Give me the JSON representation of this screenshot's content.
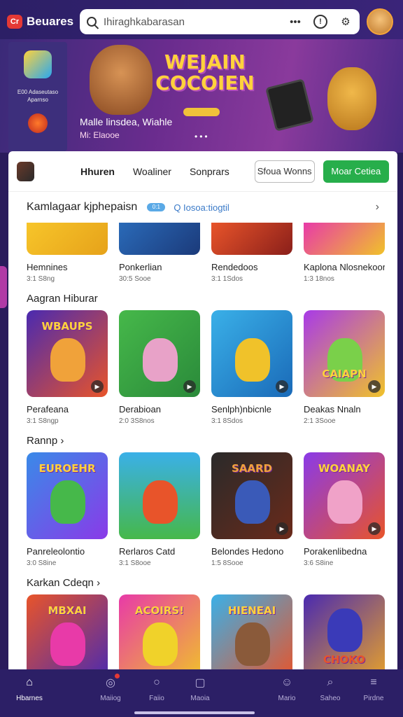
{
  "topbar": {
    "brand_logo": "Cr",
    "brand_name": "Beuares",
    "search_text": "Ihiraghkabarasan",
    "more_icon": "•••",
    "info_icon": "!",
    "gear_icon": "⚙"
  },
  "hero": {
    "title": "WEJAIN COCOIEN",
    "side_text": "E00 Adaseutaso Aparnso",
    "caption": "Malle linsdea, Wiahle",
    "sub": "Mi: Elaooe",
    "dots": "•••"
  },
  "tabs": {
    "items": [
      "Hhuren",
      "Woaliner",
      "Sonprars"
    ],
    "outline_button": "Sfoua Wonns",
    "primary_button": "Moar Cetiea"
  },
  "section1": {
    "title": "Kamlagaar kjphepaisn",
    "badge": "0:1",
    "link": "Q Iosoa:tiogtil",
    "chevron": "›",
    "cards": [
      {
        "title": "Hemnines",
        "meta": "3:1 S8ng",
        "label": "",
        "color1": "#f7c52a",
        "color2": "#e6a21a"
      },
      {
        "title": "Ponkerlian",
        "meta": "30:5 Sooe",
        "label": "",
        "color1": "#2a6ab8",
        "color2": "#1b3a7a"
      },
      {
        "title": "Rendedoos",
        "meta": "3:1 1Sdos",
        "label": "",
        "color1": "#e8542a",
        "color2": "#8a1f1a"
      },
      {
        "title": "Kaplona Nlosnekoor",
        "meta": "1:3 18nos",
        "label": "",
        "color1": "#e83aa8",
        "color2": "#f0c22a"
      }
    ]
  },
  "section2": {
    "title": "Aagran Hiburar",
    "cards": [
      {
        "title": "Perafeana",
        "meta": "3:1 S8ngp",
        "label": "WBAUPS",
        "color1": "#4a2ab0",
        "color2": "#e8542a"
      },
      {
        "title": "Derabioan",
        "meta": "2:0 3S8nos",
        "label": "",
        "color1": "#46b84a",
        "color2": "#2a8a3a"
      },
      {
        "title": "Senlph)nbicnle",
        "meta": "3:1 8Sdos",
        "label": "",
        "color1": "#3ab0e8",
        "color2": "#1a6ab8"
      },
      {
        "title": "Deakas Nnaln",
        "meta": "2:1 3Sooe",
        "label": "CAIAPN",
        "color1": "#a83ae8",
        "color2": "#f0c22a"
      }
    ]
  },
  "section3": {
    "title": "Rannp ›",
    "cards": [
      {
        "title": "Panreleolontio",
        "meta": "3:0 S8ine",
        "label": "EUROEHR",
        "color1": "#3a8ae8",
        "color2": "#8a3ae8"
      },
      {
        "title": "Rerlaros Catd",
        "meta": "3:1 S8ooe",
        "label": "",
        "color1": "#3ab0e8",
        "color2": "#46b84a"
      },
      {
        "title": "Belondes Hedono",
        "meta": "1:5 8Sooe",
        "label": "SAARD",
        "color1": "#2a2a2a",
        "color2": "#6a2a1a"
      },
      {
        "title": "Porakenlibedna",
        "meta": "3:6 S8ine",
        "label": "WOANAY",
        "color1": "#8a3ae8",
        "color2": "#e8542a"
      }
    ]
  },
  "section4": {
    "title": "Karkan Cdeqn ›",
    "cards": [
      {
        "title": "",
        "meta": "",
        "label": "MBXAI",
        "color1": "#e8542a",
        "color2": "#4a2ab0"
      },
      {
        "title": "",
        "meta": "",
        "label": "ACOIRS!",
        "color1": "#e83aa8",
        "color2": "#f0c22a"
      },
      {
        "title": "",
        "meta": "",
        "label": "HIENEAI",
        "color1": "#3ab0e8",
        "color2": "#e8542a"
      },
      {
        "title": "",
        "meta": "",
        "label": "CHOKO",
        "color1": "#4a2ab0",
        "color2": "#e8a22a"
      }
    ]
  },
  "bottomnav": {
    "items": [
      {
        "label": "Hbarnes",
        "icon": "home-icon"
      },
      {
        "label": "Maiiog",
        "icon": "gamepad-icon"
      },
      {
        "label": "Faiio",
        "icon": "circle-icon"
      },
      {
        "label": "Maoia",
        "icon": "box-icon"
      },
      {
        "label": "Mario",
        "icon": "smile-icon"
      },
      {
        "label": "Saheo",
        "icon": "search-icon"
      },
      {
        "label": "Pirdne",
        "icon": "menu-icon"
      }
    ]
  },
  "colors": {
    "brand": "#2c1f66",
    "accent_green": "#27ae4b",
    "accent_red": "#e53935"
  }
}
